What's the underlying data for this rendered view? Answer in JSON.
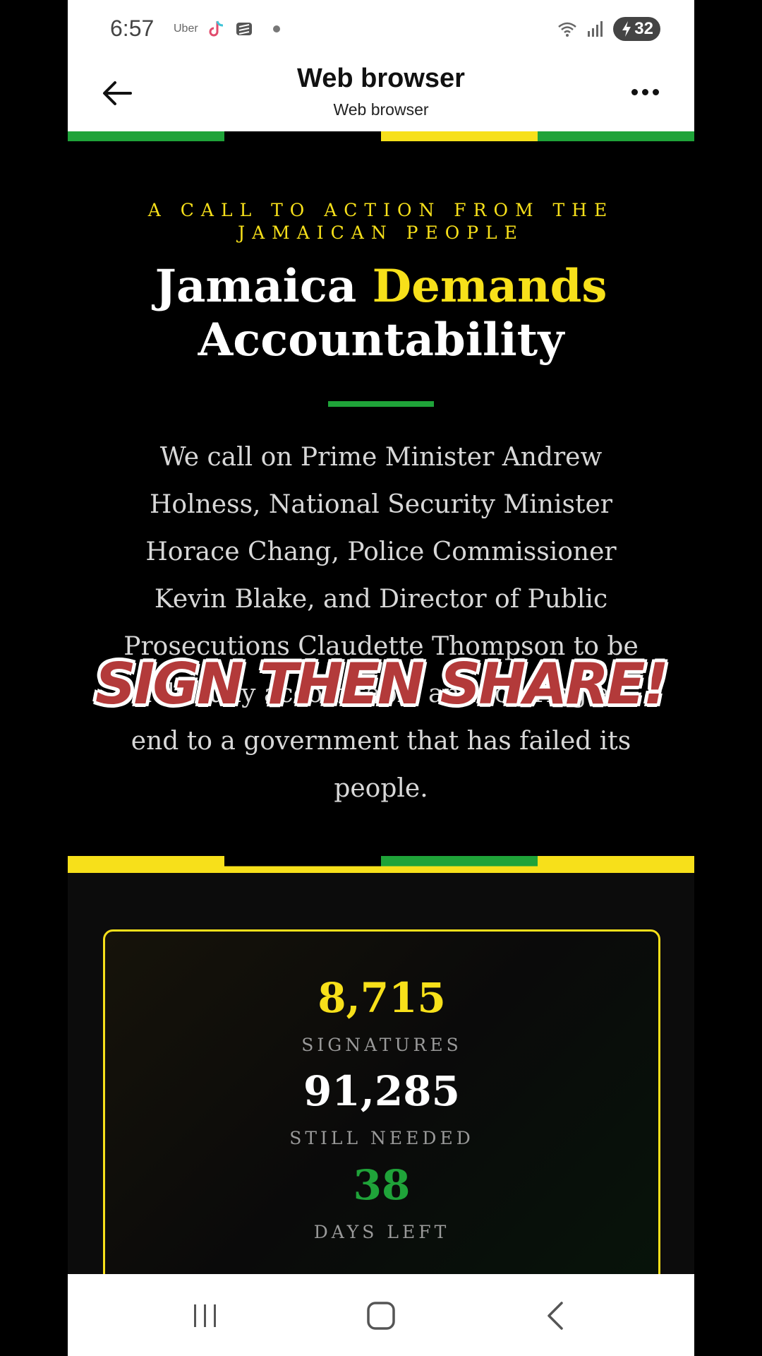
{
  "status": {
    "time": "6:57",
    "uber_label": "Uber",
    "battery": "32"
  },
  "appbar": {
    "title": "Web browser",
    "subtitle": "Web browser"
  },
  "hero": {
    "kicker": "A CALL TO ACTION FROM THE JAMAICAN PEOPLE",
    "headline_part1": "Jamaica ",
    "headline_accent": "Demands",
    "headline_part2": "Accountability",
    "body": "We call on Prime Minister Andrew Holness, National Security Minister Horace Chang, Police Commissioner Kevin Blake, and Director of Public Prosecutions Claudette Thompson to be held fully accountable and to bring an end to a government that has failed its people."
  },
  "overlay": {
    "text": "SIGN THEN SHARE!"
  },
  "stats": {
    "signatures_value": "8,715",
    "signatures_label": "SIGNATURES",
    "needed_value": "91,285",
    "needed_label": "STILL NEEDED",
    "days_value": "38",
    "days_label": "DAYS LEFT"
  },
  "colors": {
    "jamaica_green": "#1fa339",
    "jamaica_yellow": "#f7e01a",
    "jamaica_black": "#000000"
  }
}
